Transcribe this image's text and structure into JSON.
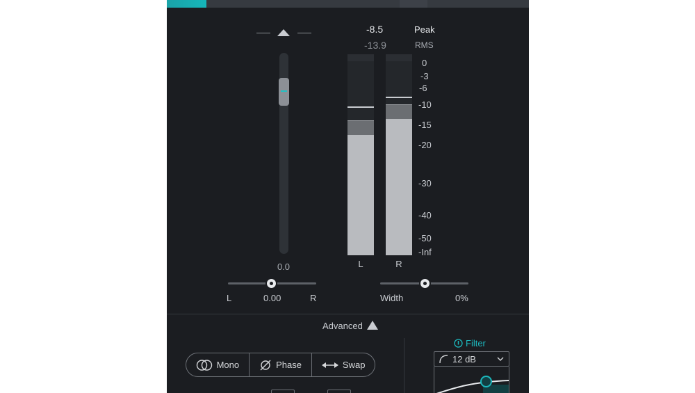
{
  "gain": {
    "value": "0.0"
  },
  "readouts": {
    "peak_value": "-8.5",
    "peak_label": "Peak",
    "rms_value": "-13.9",
    "rms_label": "RMS"
  },
  "meters": {
    "left_label": "L",
    "right_label": "R",
    "scale": [
      "0",
      "-3",
      "-6",
      "-10",
      "-15",
      "-20",
      "-30",
      "-40",
      "-50",
      "-Inf"
    ]
  },
  "pan": {
    "left_label": "L",
    "value": "0.00",
    "right_label": "R"
  },
  "width": {
    "label": "Width",
    "value": "0%"
  },
  "advanced": {
    "label": "Advanced"
  },
  "buttons": {
    "mono": "Mono",
    "phase": "Phase",
    "swap": "Swap"
  },
  "filter": {
    "title": "Filter",
    "slope": "12 dB"
  },
  "colors": {
    "accent": "#1cb8bd",
    "panel": "#1b1d21"
  }
}
